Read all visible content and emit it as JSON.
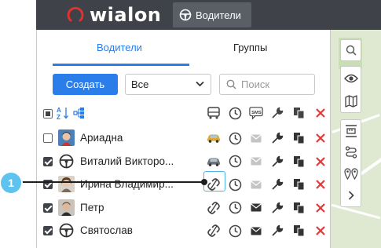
{
  "app": {
    "logo_text": "wialon",
    "top_tab_label": "Водители"
  },
  "tabs": [
    {
      "label": "Водители",
      "active": true
    },
    {
      "label": "Группы",
      "active": false
    }
  ],
  "toolbar": {
    "create_label": "Создать",
    "filter_value": "Все",
    "search_placeholder": "Поиск"
  },
  "columns": [
    "unit-icon",
    "clock-icon",
    "sms-icon",
    "wrench-icon",
    "copy-icon",
    "delete-icon"
  ],
  "header_labels": {
    "sms": "SMS"
  },
  "drivers": [
    {
      "name": "Ариадна",
      "checked": false,
      "unit": "car",
      "sms_enabled": false
    },
    {
      "name": "Виталий Викторо...",
      "checked": true,
      "unit": "car",
      "sms_enabled": false
    },
    {
      "name": "Ирина Владимир...",
      "checked": true,
      "unit": "unlink",
      "sms_enabled": false,
      "highlighted": true
    },
    {
      "name": "Петр",
      "checked": true,
      "unit": "unlink",
      "sms_enabled": true
    },
    {
      "name": "Святослав",
      "checked": true,
      "unit": "unlink",
      "sms_enabled": true
    }
  ],
  "callout": {
    "number": "1"
  },
  "colors": {
    "accent": "#2b7de9",
    "topbar": "#3f4349",
    "delete": "#e03a3a",
    "unit_car": "#e0a935",
    "callout": "#5ec3ee"
  }
}
